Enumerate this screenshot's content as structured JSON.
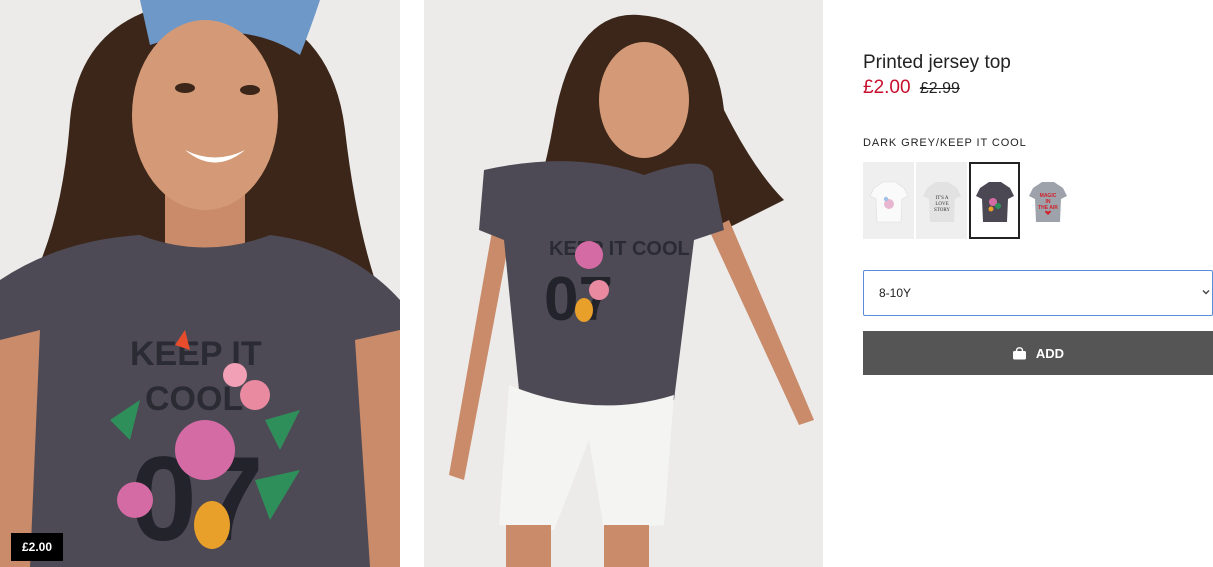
{
  "gallery": {
    "image1_alt": "",
    "price_badge": "£2.00"
  },
  "product": {
    "title": "Printed jersey top",
    "price_current": "£2.00",
    "price_original": "£2.99",
    "color_name": "DARK GREY/KEEP IT COOL",
    "swatches": [
      {
        "name": "white-unicorn",
        "selected": false
      },
      {
        "name": "light-grey-its-a-love-story",
        "selected": false
      },
      {
        "name": "dark-grey-keep-it-cool",
        "selected": true
      },
      {
        "name": "grey-magic-in-the-air",
        "selected": false
      }
    ],
    "swatch_text": {
      "story": [
        "IT'S A",
        "LOVE",
        "STORY"
      ],
      "magic": [
        "MAGIC",
        "IN",
        "THE AIR"
      ]
    },
    "size_selected": "8-10Y",
    "add_button_label": "ADD"
  },
  "colors": {
    "price_red": "#c8102e",
    "button_grey": "#555555",
    "select_border": "#5a8dd9"
  },
  "icons": {
    "bag": "shopping-bag-icon",
    "chevron": "chevron-down-icon"
  }
}
